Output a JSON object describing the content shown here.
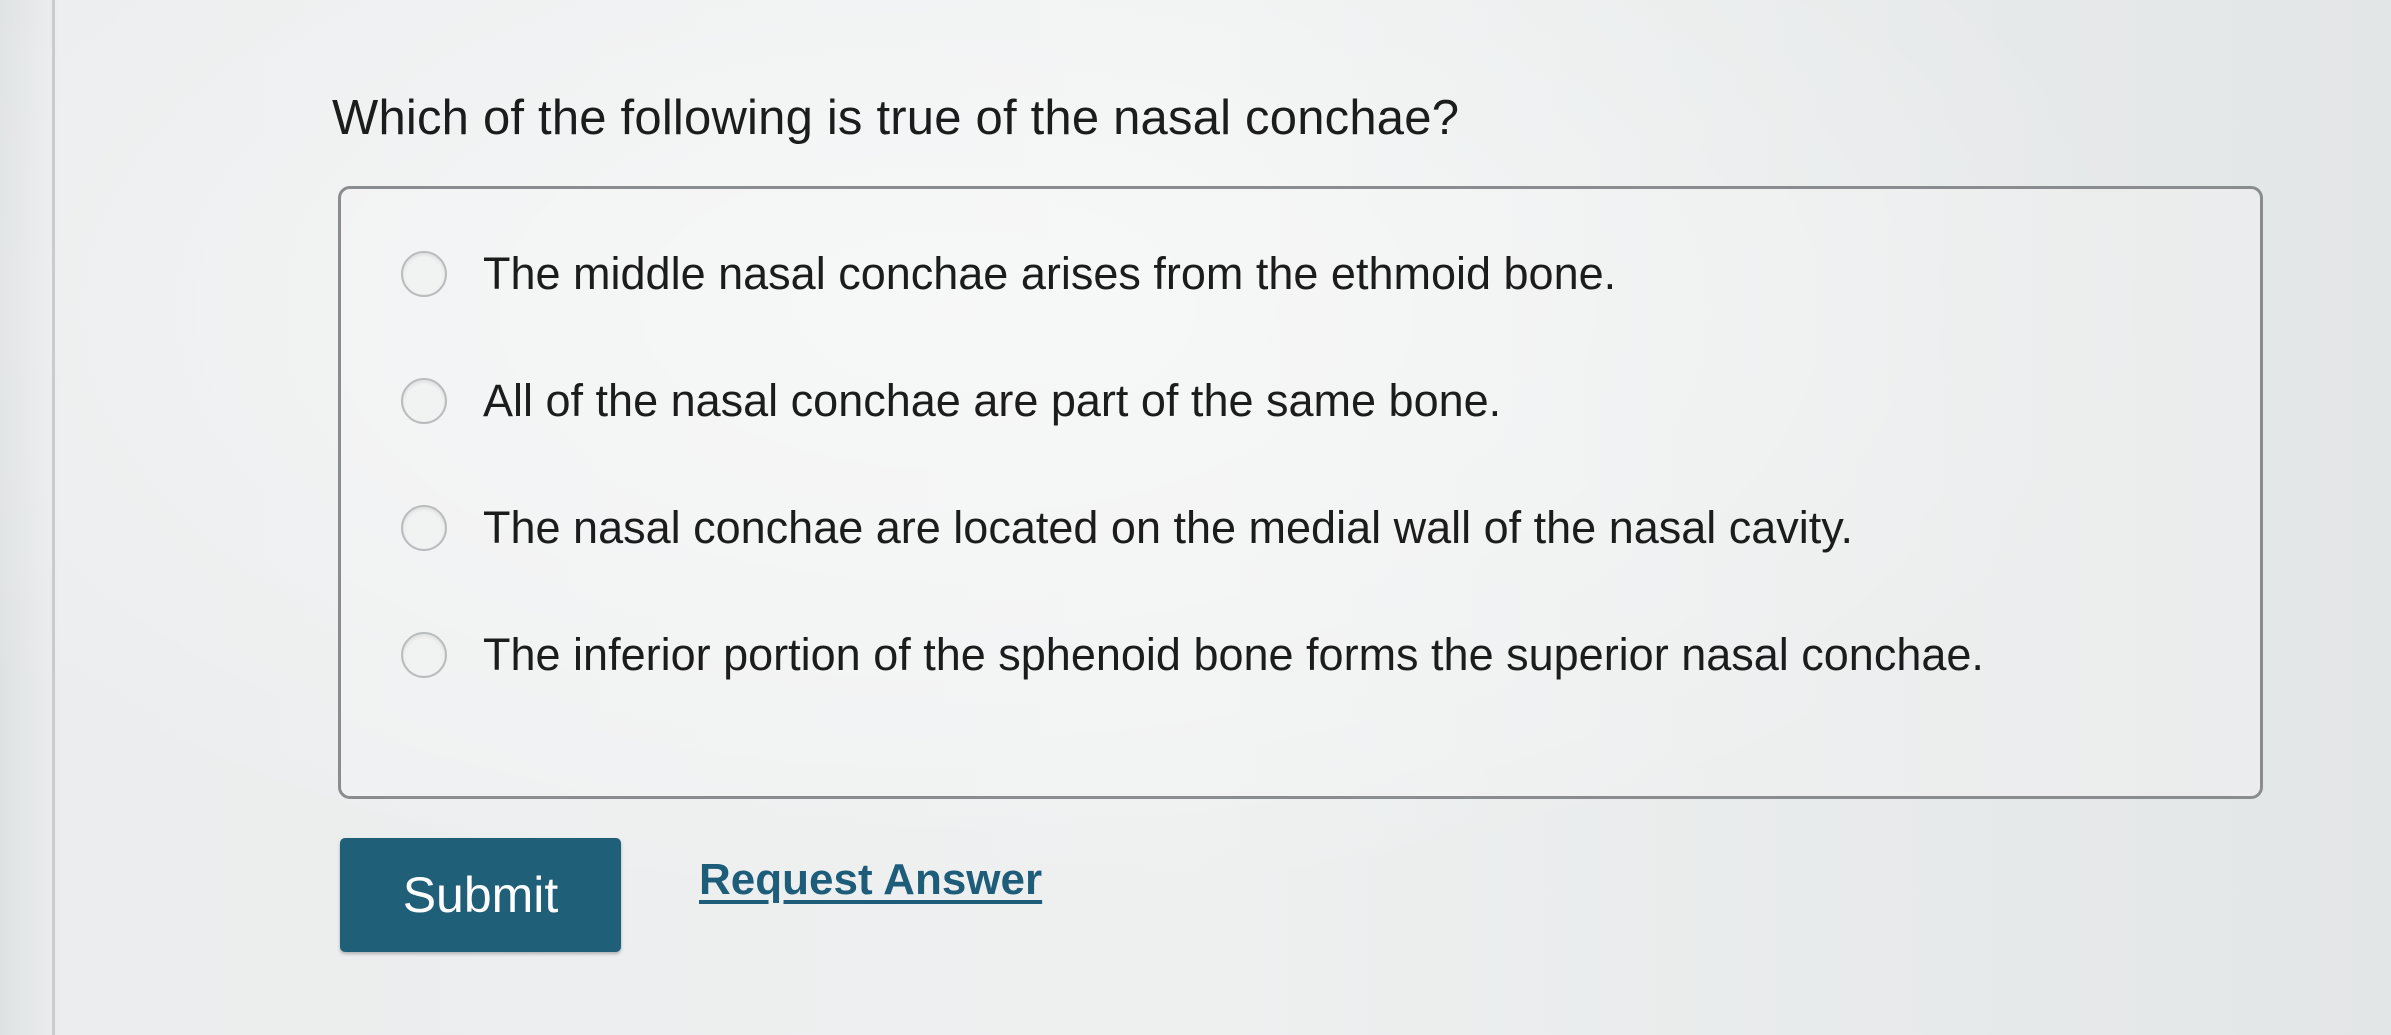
{
  "question": {
    "text": "Which of the following is true of the nasal conchae?"
  },
  "options": [
    {
      "label": "The middle nasal conchae arises from the ethmoid bone.",
      "selected": false
    },
    {
      "label": "All of the nasal conchae are part of the same bone.",
      "selected": false
    },
    {
      "label": "The nasal conchae are located on the medial wall of the nasal cavity.",
      "selected": false
    },
    {
      "label": "The inferior portion of the sphenoid bone forms the superior nasal conchae.",
      "selected": false
    }
  ],
  "actions": {
    "submit_label": "Submit",
    "request_answer_label": "Request Answer"
  },
  "colors": {
    "submit_background": "#1f5f78",
    "link": "#1e5d79"
  }
}
